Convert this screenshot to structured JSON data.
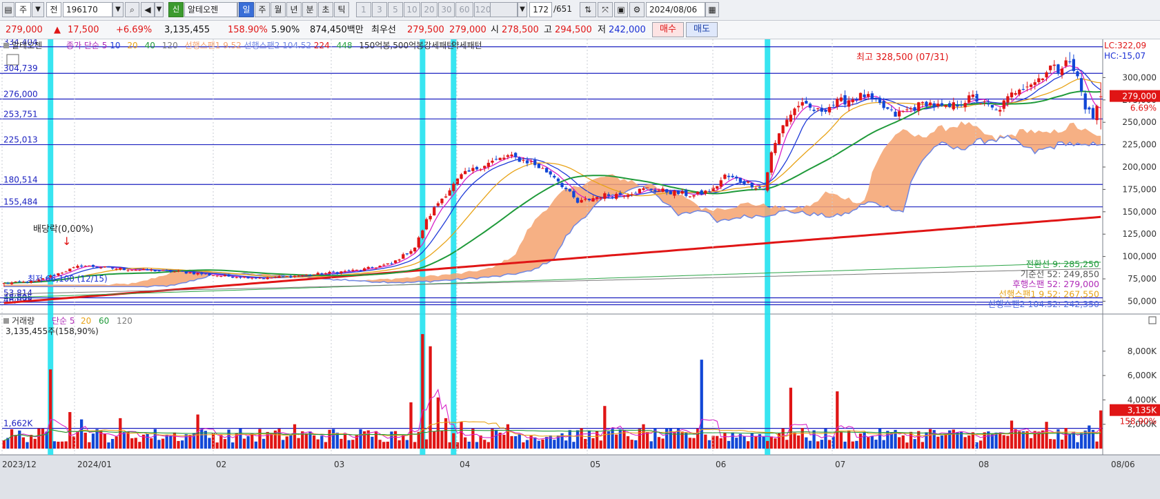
{
  "toolbar": {
    "period_main": "주",
    "prefix": "전",
    "code": "196170",
    "badge": "신",
    "stock_name": "알테오젠",
    "periods": [
      {
        "label": "일",
        "state": "sel"
      },
      {
        "label": "주",
        "state": "normal"
      },
      {
        "label": "월",
        "state": "normal"
      },
      {
        "label": "년",
        "state": "normal"
      },
      {
        "label": "분",
        "state": "normal"
      },
      {
        "label": "초",
        "state": "normal"
      },
      {
        "label": "틱",
        "state": "normal"
      }
    ],
    "ticks": [
      "1",
      "3",
      "5",
      "10",
      "20",
      "30",
      "60",
      "120"
    ],
    "count": "172",
    "total": "/651",
    "date": "2024/08/06"
  },
  "quote": {
    "price": "279,000",
    "change": "17,500",
    "change_pct": "+6.69%",
    "volume": "3,135,455",
    "volume_ratio": "158.90%",
    "turnover_pct": "5.90%",
    "amount": "874,450백만",
    "best_label": "최우선",
    "ask": "279,500",
    "bid": "279,000",
    "open_label": "시",
    "open": "278,500",
    "high_label": "고",
    "high": "294,500",
    "low_label": "저",
    "low": "242,000",
    "buy_btn": "매수",
    "sell_btn": "매도"
  },
  "colors": {
    "up": "#e01515",
    "down": "#1247d6",
    "ma5": "#d822c8",
    "ma10": "#1f3bd8",
    "ma20": "#e8a317",
    "ma40": "#1f9a3a",
    "ma120": "#7a7a7a",
    "span": "#f5a26f",
    "span_line": "#6f86e2",
    "ma224": "#e01515",
    "ma448": "#2aa345",
    "hline": "#1a1fbf",
    "highlight": "#22e2f0"
  },
  "chart_data": [
    {
      "type": "candlestick",
      "legend": {
        "title": "알테오젠",
        "items": [
          "종가 단순 5",
          "10",
          "20",
          "40",
          "120",
          "선행스팬1 9.52",
          "선행스팬2 104.52",
          "224",
          "448",
          "150억봉,500억봉",
          "강세패턴",
          "약세패턴"
        ]
      },
      "x_labels": [
        "2023/12",
        "2024/01",
        "02",
        "03",
        "04",
        "05",
        "06",
        "07",
        "08"
      ],
      "right_label": "08/06",
      "y_ticks": [
        50000,
        75000,
        100000,
        125000,
        150000,
        175000,
        200000,
        225000,
        250000,
        275000,
        300000
      ],
      "ylim": [
        38000,
        335000
      ],
      "top_labels": [
        "LC:322,09",
        "HC:-15,07"
      ],
      "last_price_label": "279,000",
      "last_pct_label": "6.69%",
      "hlines": [
        {
          "value": 334404,
          "label": "334,404"
        },
        {
          "value": 304739,
          "label": "304,739"
        },
        {
          "value": 276000,
          "label": "276,000"
        },
        {
          "value": 253751,
          "label": "253,751"
        },
        {
          "value": 225013,
          "label": "225,013"
        },
        {
          "value": 180514,
          "label": "180,514"
        },
        {
          "value": 155484,
          "label": "155,484"
        },
        {
          "value": 53814,
          "label": "53,814"
        },
        {
          "value": 48895,
          "label": "48,895"
        },
        {
          "value": 46095,
          "label": "46,095"
        }
      ],
      "highlight_bars": [
        12,
        108,
        116,
        197
      ],
      "annotations": {
        "high": "최고 328,500 (07/31)",
        "low": "최저 66,100 (12/15)",
        "dividend": "배당락(0,00%)"
      },
      "info_lines": [
        "전환선 9: 285,250",
        "기준선 52: 249,850",
        "후행스팬 52: 279,000",
        "선행스팬1 9.52: 267,550",
        "선행스팬2 104.52: 242,350"
      ],
      "anchors": {
        "idx": [
          0,
          8,
          20,
          30,
          45,
          57,
          68,
          80,
          92,
          100,
          106,
          109,
          112,
          114,
          118,
          124,
          130,
          136,
          142,
          148,
          154,
          160,
          166,
          172,
          178,
          183,
          186,
          192,
          196,
          198,
          201,
          205,
          210,
          215,
          222,
          230,
          238,
          243,
          250,
          256,
          262,
          266,
          270,
          272,
          274,
          277,
          279,
          281,
          283
        ],
        "close": [
          70000,
          72000,
          90000,
          86000,
          83000,
          78000,
          76000,
          80000,
          85000,
          92000,
          110000,
          140000,
          160000,
          170000,
          190000,
          203000,
          212000,
          205000,
          190000,
          160000,
          168000,
          170000,
          176000,
          172000,
          168000,
          175000,
          190000,
          182000,
          175000,
          215000,
          248000,
          270000,
          262000,
          272000,
          280000,
          258000,
          272000,
          265000,
          278000,
          262000,
          290000,
          295000,
          312000,
          308000,
          322000,
          300000,
          268000,
          255000,
          279000
        ]
      },
      "bar_count": 284
    },
    {
      "type": "bar",
      "legend": {
        "title": "거래량",
        "items": [
          "단순 5",
          "20",
          "60",
          "120"
        ]
      },
      "summary_label": "3,135,455주(158,90%)",
      "ref_line": {
        "value": 1662,
        "label": "1,662K"
      },
      "y_ticks": [
        2000,
        4000,
        6000,
        8000
      ],
      "y_tick_labels": [
        "2,000K",
        "4,000K",
        "6,000K",
        "8,000K"
      ],
      "ylim": [
        0,
        9800
      ],
      "last_label": "3,135K",
      "last_pct_label": "158,90%",
      "spikes": {
        "idx": [
          12,
          17,
          20,
          30,
          50,
          75,
          88,
          100,
          105,
          108,
          110,
          112,
          114,
          118,
          130,
          155,
          165,
          180,
          203,
          215,
          239,
          260,
          269,
          280,
          283
        ],
        "value": [
          6500,
          3000,
          2400,
          2500,
          2800,
          2000,
          1200,
          1400,
          3800,
          9400,
          8400,
          4200,
          2500,
          2200,
          2000,
          3500,
          2000,
          7300,
          5000,
          4700,
          1600,
          2300,
          2200,
          1900,
          3135
        ]
      }
    }
  ]
}
